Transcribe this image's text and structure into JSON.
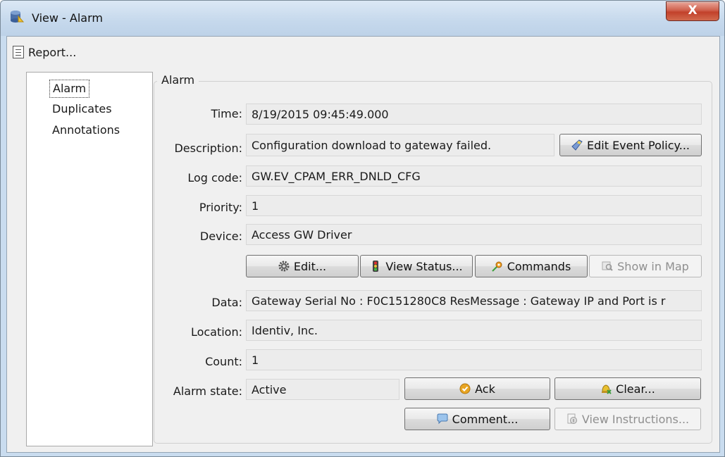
{
  "window": {
    "title": "View - Alarm",
    "close_label": "X"
  },
  "menu": {
    "report_label": "Report..."
  },
  "nav": {
    "items": [
      "Alarm",
      "Duplicates",
      "Annotations"
    ]
  },
  "group": {
    "title": "Alarm"
  },
  "fields": {
    "time": {
      "label": "Time:",
      "value": "8/19/2015 09:45:49.000"
    },
    "description": {
      "label": "Description:",
      "value": "Configuration download to gateway failed."
    },
    "log_code": {
      "label": "Log code:",
      "value": "GW.EV_CPAM_ERR_DNLD_CFG"
    },
    "priority": {
      "label": "Priority:",
      "value": "1"
    },
    "device": {
      "label": "Device:",
      "value": "Access GW Driver"
    },
    "data": {
      "label": "Data:",
      "value": "Gateway Serial No : F0C151280C8  ResMessage : Gateway IP and Port is r"
    },
    "location": {
      "label": "Location:",
      "value": "Identiv, Inc."
    },
    "count": {
      "label": "Count:",
      "value": "1"
    },
    "alarm_state": {
      "label": "Alarm state:",
      "value": "Active"
    }
  },
  "buttons": {
    "edit_event_policy": "Edit Event Policy...",
    "edit": "Edit...",
    "view_status": "View Status...",
    "commands": "Commands",
    "show_in_map": "Show in Map",
    "ack": "Ack",
    "clear": "Clear...",
    "comment": "Comment...",
    "view_instructions": "View Instructions..."
  },
  "icons": {
    "app": "database-alarm-icon",
    "report": "report-icon",
    "edit_event_policy": "policy-edit-icon",
    "edit": "gear-icon",
    "view_status": "traffic-light-icon",
    "commands": "command-icon",
    "show_in_map": "map-search-icon",
    "ack": "check-circle-icon",
    "clear": "bell-icon",
    "comment": "speech-bubble-icon",
    "view_instructions": "instructions-icon"
  },
  "colors": {
    "close": "#c2412b",
    "ack": "#e8a522",
    "titlebar": "#c5d8ec"
  }
}
